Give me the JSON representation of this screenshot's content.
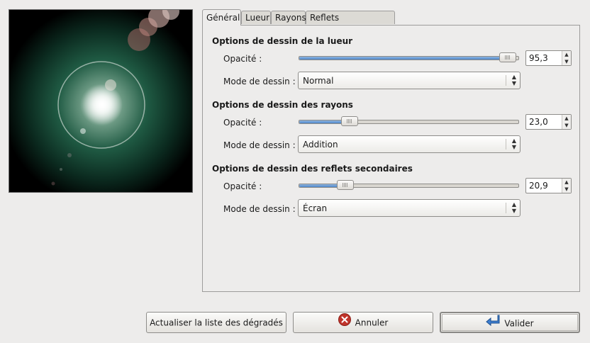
{
  "preview": {
    "alt_name": "lens-flare-preview"
  },
  "tabs": [
    {
      "label": "Général",
      "active": true
    },
    {
      "label": "Lueur",
      "active": false
    },
    {
      "label": "Rayons",
      "active": false
    },
    {
      "label": "Reflets secondaires",
      "active": false
    }
  ],
  "sections": [
    {
      "title": "Options de dessin de la lueur",
      "opacity_label": "Opacité :",
      "opacity_value": "95,3",
      "opacity_fraction": 0.953,
      "mode_label": "Mode de dessin :",
      "mode_value": "Normal"
    },
    {
      "title": "Options de dessin des rayons",
      "opacity_label": "Opacité :",
      "opacity_value": "23,0",
      "opacity_fraction": 0.23,
      "mode_label": "Mode de dessin :",
      "mode_value": "Addition"
    },
    {
      "title": "Options de dessin des reflets secondaires",
      "opacity_label": "Opacité :",
      "opacity_value": "20,9",
      "opacity_fraction": 0.209,
      "mode_label": "Mode de dessin :",
      "mode_value": "Écran"
    }
  ],
  "buttons": {
    "refresh_label": "Actualiser la liste des dégradés",
    "cancel_label": "Annuler",
    "ok_label": "Valider"
  },
  "colors": {
    "slider_fill": "#4f86c8",
    "cancel_icon": "#c0342b",
    "ok_icon": "#3d7fd1"
  }
}
